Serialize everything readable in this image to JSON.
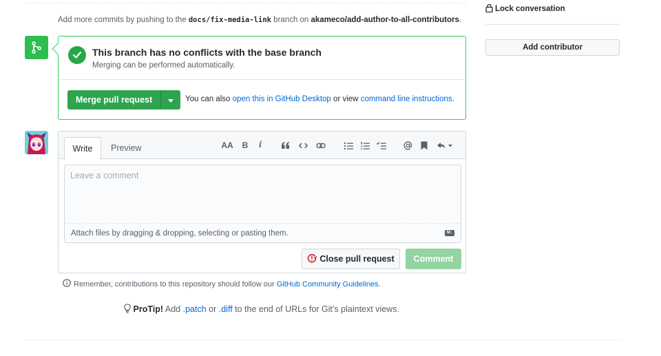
{
  "commit_note": {
    "prefix": "Add more commits by pushing to the",
    "branch": "docs/fix-media-link",
    "middle": "branch on",
    "repo": "akameco/add-author-to-all-contributors",
    "suffix": "."
  },
  "merge": {
    "title": "This branch has no conflicts with the base branch",
    "subtitle": "Merging can be performed automatically.",
    "button_label": "Merge pull request",
    "also_prefix": "You can also",
    "desktop_link": "open this in GitHub Desktop",
    "also_middle": "or view",
    "cli_link": "command line instructions",
    "also_suffix": "."
  },
  "comment": {
    "tabs": [
      "Write",
      "Preview"
    ],
    "toolbar": [
      "text-size",
      "bold",
      "italic",
      "quote",
      "code",
      "link",
      "unordered-list",
      "ordered-list",
      "task-list",
      "mention",
      "saved-reply",
      "reply"
    ],
    "toolbar_glyphs": {
      "text-size": "AA",
      "bold": "B",
      "italic": "i"
    },
    "placeholder": "Leave a comment",
    "attach_hint": "Attach files by dragging & dropping, selecting or pasting them.",
    "close_label": "Close pull request",
    "comment_label": "Comment"
  },
  "guidelines": {
    "prefix": "Remember, contributions to this repository should follow our",
    "link": "GitHub Community Guidelines",
    "suffix": "."
  },
  "protip": {
    "label": "ProTip!",
    "pre": "Add",
    "patch": ".patch",
    "or": "or",
    "diff": ".diff",
    "post": "to the end of URLs for Git’s plaintext views."
  },
  "sidebar": {
    "lock_label": "Lock conversation",
    "add_contributor_label": "Add contributor"
  },
  "colors": {
    "merge_green": "#2ea44f",
    "border_green": "#34d058",
    "link_blue": "#0366d6",
    "comment_disabled": "#94d3a2"
  }
}
